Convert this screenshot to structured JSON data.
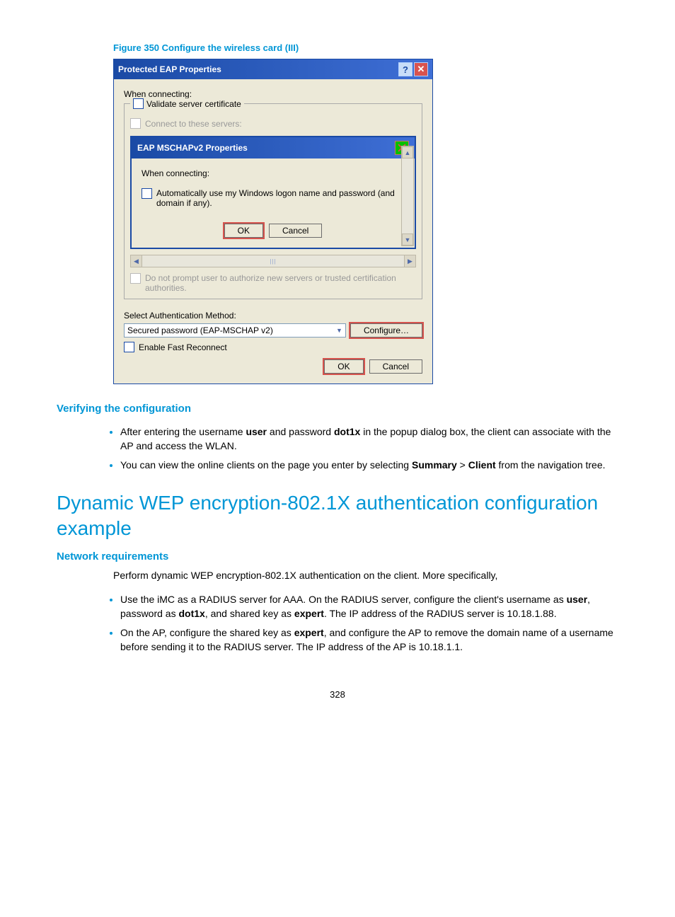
{
  "figureCaption": "Figure 350 Configure the wireless card (III)",
  "outerDialog": {
    "title": "Protected EAP Properties",
    "help": "?",
    "close": "✕",
    "whenConnecting": "When connecting:",
    "validateCert": "Validate server certificate",
    "connectServers": "Connect to these servers:",
    "doNotPrompt": "Do not prompt user to authorize new servers or trusted certification authorities.",
    "selectAuth": "Select Authentication Method:",
    "authValue": "Secured password (EAP-MSCHAP v2)",
    "configure": "Configure…",
    "fastReconnect": "Enable Fast Reconnect",
    "ok": "OK",
    "cancel": "Cancel"
  },
  "innerDialog": {
    "title": "EAP MSCHAPv2 Properties",
    "whenConnecting": "When connecting:",
    "autoLogon": "Automatically use my Windows logon name and password (and domain if any).",
    "ok": "OK",
    "cancel": "Cancel"
  },
  "verifyHeading": "Verifying the configuration",
  "bullets1": {
    "a_pre": "After entering the username ",
    "a_user": "user",
    "a_mid": " and password ",
    "a_pw": "dot1x",
    "a_post": " in the popup dialog box, the client can associate with the AP and access the WLAN.",
    "b_pre": "You can view the online clients on the page you enter by selecting ",
    "b_sum": "Summary",
    "b_gt": " > ",
    "b_client": "Client",
    "b_post": " from the navigation tree."
  },
  "h2": "Dynamic WEP encryption-802.1X authentication configuration example",
  "netReq": "Network requirements",
  "intro": "Perform dynamic WEP encryption-802.1X authentication on the client. More specifically,",
  "bullets2": {
    "a_pre": "Use the iMC as a RADIUS server for AAA. On the RADIUS server, configure the client's username as ",
    "a_user": "user",
    "a_m1": ", password as ",
    "a_pw": "dot1x",
    "a_m2": ", and shared key as ",
    "a_key": "expert",
    "a_post": ". The IP address of the RADIUS server is 10.18.1.88.",
    "b_pre": "On the AP, configure the shared key as ",
    "b_key": "expert",
    "b_post": ", and configure the AP to remove the domain name of a username before sending it to the RADIUS server. The IP address of the AP is 10.18.1.1."
  },
  "pageNumber": "328"
}
